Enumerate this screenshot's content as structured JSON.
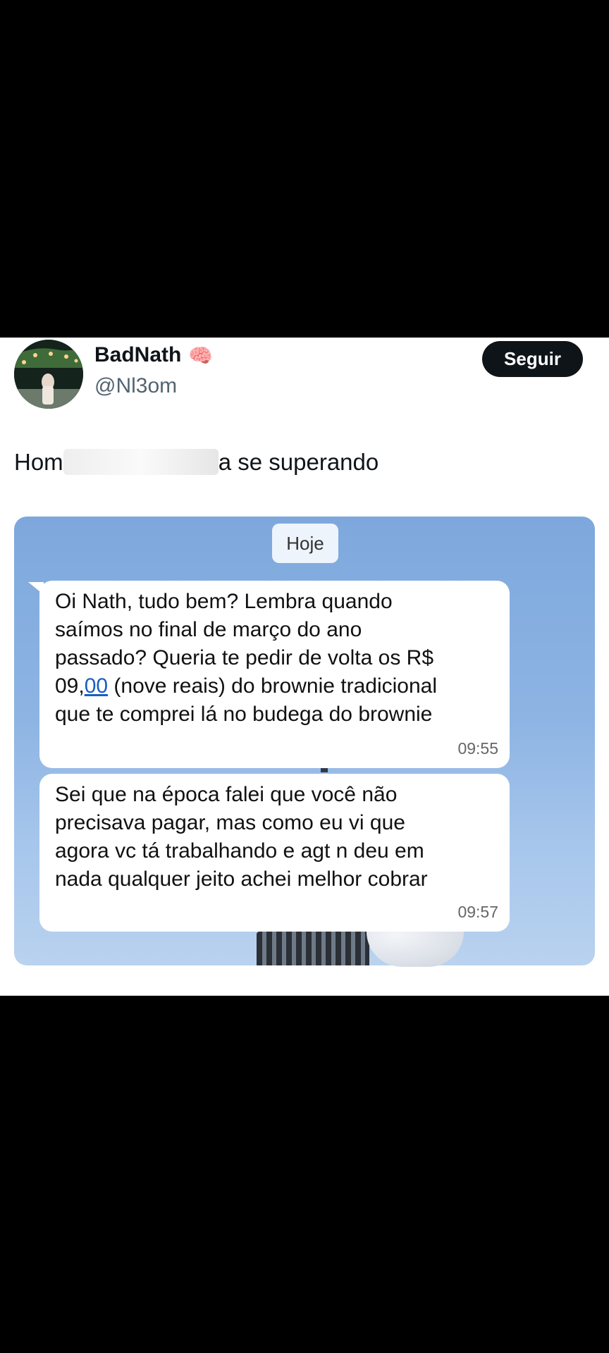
{
  "user": {
    "name": "BadNath",
    "badge_emoji": "🧠",
    "handle": "@Nl3om"
  },
  "follow_button": {
    "label": "Seguir"
  },
  "tweet": {
    "text_start": "Hom",
    "text_end": "a se superando"
  },
  "chat": {
    "date_label": "Hoje",
    "messages": [
      {
        "line1": "Oi Nath, tudo bem? Lembra quando",
        "line2": "saímos no final de março do ano",
        "line3": "passado? Queria te pedir de volta os R$",
        "line4_a": "09,",
        "line4_link": "00",
        "line4_b": " (nove reais) do brownie tradicional",
        "line5": "que te comprei lá no budega do brownie",
        "time": "09:55"
      },
      {
        "line1": "Sei que na época falei que você não",
        "line2": "precisava pagar, mas como eu vi que",
        "line3": "agora vc tá trabalhando e agt n deu em",
        "line4": "nada qualquer jeito achei melhor cobrar",
        "time": "09:57"
      }
    ]
  },
  "colors": {
    "sky": "#8db4e3",
    "bubble": "#ffffff",
    "button": "#0f1419",
    "link": "#1a5ec2"
  }
}
